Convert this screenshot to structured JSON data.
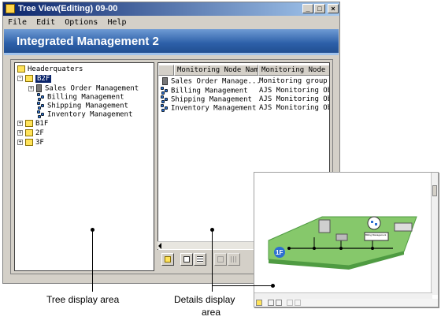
{
  "window": {
    "title": "Tree View(Editing) 09-00",
    "min_glyph": "_",
    "max_glyph": "□",
    "close_glyph": "×"
  },
  "menu": [
    "File",
    "Edit",
    "Options",
    "Help"
  ],
  "banner": {
    "title": "Integrated Management 2"
  },
  "tree": {
    "root": "Headerquaters",
    "nodes": [
      {
        "label": "B2F",
        "selected": true,
        "expanded": true
      },
      {
        "label": "Sales Order Management"
      },
      {
        "label": "Billing Management"
      },
      {
        "label": "Shipping Management"
      },
      {
        "label": "Inventory Management"
      },
      {
        "label": "B1F"
      },
      {
        "label": "2F"
      },
      {
        "label": "3F"
      }
    ],
    "expander_plus": "+",
    "expander_minus": "-"
  },
  "details": {
    "columns": [
      "Monitoring Node Name",
      "Monitoring Node Type"
    ],
    "rows": [
      [
        "Sales Order Manage...",
        "Monitoring group"
      ],
      [
        "Billing Management",
        "AJS Monitoring Ob"
      ],
      [
        "Shipping Management",
        "AJS Monitoring Ob"
      ],
      [
        "Inventory Management",
        "AJS Monitoring Ob"
      ]
    ]
  },
  "map": {
    "floor_badge": "1F",
    "billing_label": "Billing Management",
    "colors": {
      "floor_top": "#86c86b",
      "floor_side": "#4f9b42",
      "badge": "#2e6fd1"
    }
  },
  "annotations": {
    "tree_area": "Tree display area",
    "details_area_line1": "Details display",
    "details_area_line2": "area"
  }
}
